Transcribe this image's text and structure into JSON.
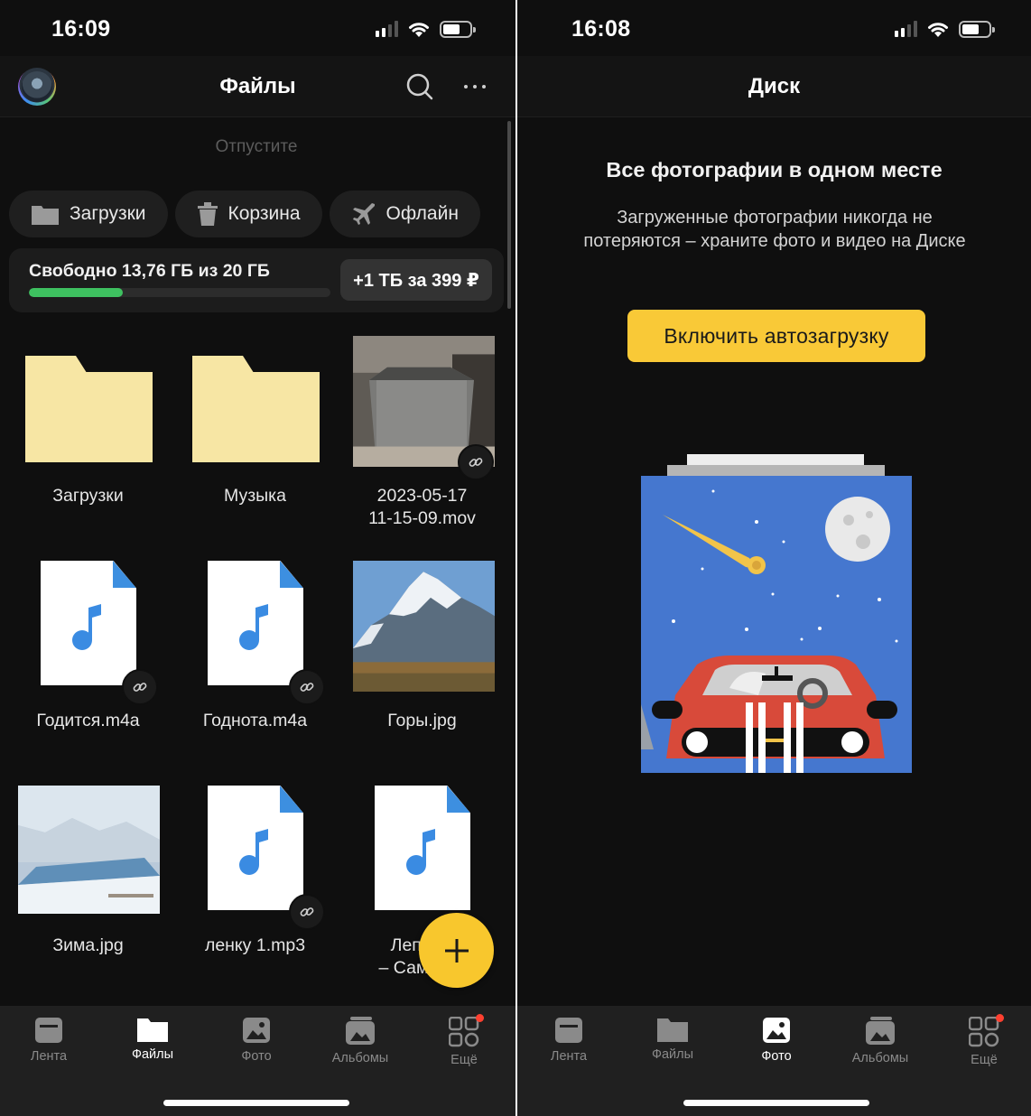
{
  "left": {
    "status_time": "16:09",
    "header_title": "Файлы",
    "pull_hint": "Отпустите",
    "chips": [
      {
        "icon": "folder-icon",
        "label": "Загрузки"
      },
      {
        "icon": "trash-icon",
        "label": "Корзина"
      },
      {
        "icon": "airplane-icon",
        "label": "Офлайн"
      }
    ],
    "storage": {
      "text": "Свободно 13,76 ГБ из 20 ГБ",
      "used_fraction": 0.312,
      "upgrade_label": "+1 ТБ за 399 ₽",
      "bar_color": "#3ec160"
    },
    "files": [
      {
        "type": "folder",
        "name": "Загрузки"
      },
      {
        "type": "folder",
        "name": "Музыка"
      },
      {
        "type": "video",
        "name": "2023-05-17\n11-15-09.mov",
        "shared": true
      },
      {
        "type": "audio",
        "name": "Годится.m4a",
        "shared": true
      },
      {
        "type": "audio",
        "name": "Годнота.m4a",
        "shared": true
      },
      {
        "type": "image",
        "name": "Горы.jpg"
      },
      {
        "type": "image",
        "name": "Зима.jpg"
      },
      {
        "type": "audio",
        "name": "ленку 1.mp3",
        "shared": true
      },
      {
        "type": "audio",
        "name": "Лепс Гр\n– Самы...3"
      }
    ],
    "fab_icon": "plus-icon"
  },
  "right": {
    "status_time": "16:08",
    "header_title": "Диск",
    "promo_title": "Все фотографии в одном месте",
    "promo_text": "Загруженные фотографии никогда не потеряются – храните фото и видео на Диске",
    "promo_button": "Включить автозагрузку",
    "accent_color": "#f9c937"
  },
  "tabbar": {
    "items": [
      {
        "icon": "feed-icon",
        "label": "Лента"
      },
      {
        "icon": "files-icon",
        "label": "Файлы"
      },
      {
        "icon": "photo-icon",
        "label": "Фото"
      },
      {
        "icon": "albums-icon",
        "label": "Альбомы"
      },
      {
        "icon": "more-grid-icon",
        "label": "Ещё"
      }
    ],
    "left_active": "Файлы",
    "right_active": "Фото"
  }
}
